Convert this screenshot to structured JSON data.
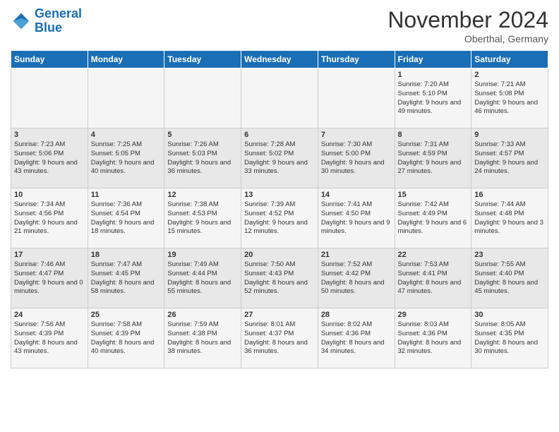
{
  "logo": {
    "line1": "General",
    "line2": "Blue"
  },
  "title": "November 2024",
  "location": "Oberthal, Germany",
  "days_of_week": [
    "Sunday",
    "Monday",
    "Tuesday",
    "Wednesday",
    "Thursday",
    "Friday",
    "Saturday"
  ],
  "weeks": [
    [
      {
        "day": "",
        "info": ""
      },
      {
        "day": "",
        "info": ""
      },
      {
        "day": "",
        "info": ""
      },
      {
        "day": "",
        "info": ""
      },
      {
        "day": "",
        "info": ""
      },
      {
        "day": "1",
        "info": "Sunrise: 7:20 AM\nSunset: 5:10 PM\nDaylight: 9 hours and 49 minutes."
      },
      {
        "day": "2",
        "info": "Sunrise: 7:21 AM\nSunset: 5:08 PM\nDaylight: 9 hours and 46 minutes."
      }
    ],
    [
      {
        "day": "3",
        "info": "Sunrise: 7:23 AM\nSunset: 5:06 PM\nDaylight: 9 hours and 43 minutes."
      },
      {
        "day": "4",
        "info": "Sunrise: 7:25 AM\nSunset: 5:05 PM\nDaylight: 9 hours and 40 minutes."
      },
      {
        "day": "5",
        "info": "Sunrise: 7:26 AM\nSunset: 5:03 PM\nDaylight: 9 hours and 36 minutes."
      },
      {
        "day": "6",
        "info": "Sunrise: 7:28 AM\nSunset: 5:02 PM\nDaylight: 9 hours and 33 minutes."
      },
      {
        "day": "7",
        "info": "Sunrise: 7:30 AM\nSunset: 5:00 PM\nDaylight: 9 hours and 30 minutes."
      },
      {
        "day": "8",
        "info": "Sunrise: 7:31 AM\nSunset: 4:59 PM\nDaylight: 9 hours and 27 minutes."
      },
      {
        "day": "9",
        "info": "Sunrise: 7:33 AM\nSunset: 4:57 PM\nDaylight: 9 hours and 24 minutes."
      }
    ],
    [
      {
        "day": "10",
        "info": "Sunrise: 7:34 AM\nSunset: 4:56 PM\nDaylight: 9 hours and 21 minutes."
      },
      {
        "day": "11",
        "info": "Sunrise: 7:36 AM\nSunset: 4:54 PM\nDaylight: 9 hours and 18 minutes."
      },
      {
        "day": "12",
        "info": "Sunrise: 7:38 AM\nSunset: 4:53 PM\nDaylight: 9 hours and 15 minutes."
      },
      {
        "day": "13",
        "info": "Sunrise: 7:39 AM\nSunset: 4:52 PM\nDaylight: 9 hours and 12 minutes."
      },
      {
        "day": "14",
        "info": "Sunrise: 7:41 AM\nSunset: 4:50 PM\nDaylight: 9 hours and 9 minutes."
      },
      {
        "day": "15",
        "info": "Sunrise: 7:42 AM\nSunset: 4:49 PM\nDaylight: 9 hours and 6 minutes."
      },
      {
        "day": "16",
        "info": "Sunrise: 7:44 AM\nSunset: 4:48 PM\nDaylight: 9 hours and 3 minutes."
      }
    ],
    [
      {
        "day": "17",
        "info": "Sunrise: 7:46 AM\nSunset: 4:47 PM\nDaylight: 9 hours and 0 minutes."
      },
      {
        "day": "18",
        "info": "Sunrise: 7:47 AM\nSunset: 4:45 PM\nDaylight: 8 hours and 58 minutes."
      },
      {
        "day": "19",
        "info": "Sunrise: 7:49 AM\nSunset: 4:44 PM\nDaylight: 8 hours and 55 minutes."
      },
      {
        "day": "20",
        "info": "Sunrise: 7:50 AM\nSunset: 4:43 PM\nDaylight: 8 hours and 52 minutes."
      },
      {
        "day": "21",
        "info": "Sunrise: 7:52 AM\nSunset: 4:42 PM\nDaylight: 8 hours and 50 minutes."
      },
      {
        "day": "22",
        "info": "Sunrise: 7:53 AM\nSunset: 4:41 PM\nDaylight: 8 hours and 47 minutes."
      },
      {
        "day": "23",
        "info": "Sunrise: 7:55 AM\nSunset: 4:40 PM\nDaylight: 8 hours and 45 minutes."
      }
    ],
    [
      {
        "day": "24",
        "info": "Sunrise: 7:56 AM\nSunset: 4:39 PM\nDaylight: 8 hours and 43 minutes."
      },
      {
        "day": "25",
        "info": "Sunrise: 7:58 AM\nSunset: 4:39 PM\nDaylight: 8 hours and 40 minutes."
      },
      {
        "day": "26",
        "info": "Sunrise: 7:59 AM\nSunset: 4:38 PM\nDaylight: 8 hours and 38 minutes."
      },
      {
        "day": "27",
        "info": "Sunrise: 8:01 AM\nSunset: 4:37 PM\nDaylight: 8 hours and 36 minutes."
      },
      {
        "day": "28",
        "info": "Sunrise: 8:02 AM\nSunset: 4:36 PM\nDaylight: 8 hours and 34 minutes."
      },
      {
        "day": "29",
        "info": "Sunrise: 8:03 AM\nSunset: 4:36 PM\nDaylight: 8 hours and 32 minutes."
      },
      {
        "day": "30",
        "info": "Sunrise: 8:05 AM\nSunset: 4:35 PM\nDaylight: 8 hours and 30 minutes."
      }
    ]
  ]
}
